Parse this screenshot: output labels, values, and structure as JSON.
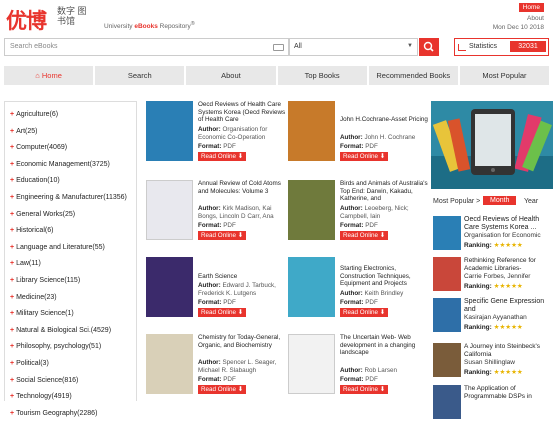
{
  "header": {
    "logo_cn": "优博",
    "logo_small": "数字 图书馆",
    "repo_prefix": "University ",
    "repo_brand": "eBooks",
    "repo_suffix": " Repository",
    "home": "Home",
    "about": "About",
    "date": "Mon Dec 10 2018"
  },
  "search": {
    "placeholder": "Search eBooks",
    "scope": "All"
  },
  "stats": {
    "label": "Statistics",
    "count": "32031"
  },
  "nav": [
    "Home",
    "Search",
    "About",
    "Top Books",
    "Recommended Books",
    "Most Popular"
  ],
  "categories": [
    "Agriculture(6)",
    "Art(25)",
    "Computer(4069)",
    "Economic Management(3725)",
    "Education(10)",
    "Engineering & Manufacturer(11356)",
    "General Works(25)",
    "Historical(6)",
    "Language and Literature(55)",
    "Law(11)",
    "Library Science(115)",
    "Medicine(23)",
    "Military Science(1)",
    "Natural & Biological Sci.(4529)",
    "Philosophy, psychology(51)",
    "Political(3)",
    "Social Science(816)",
    "Technology(4919)",
    "Tourism Geography(2286)"
  ],
  "labels": {
    "author": "Author:",
    "format": "Format:",
    "read": "Read Online",
    "ranking": "Ranking:"
  },
  "books": [
    {
      "title": "Oecd Reviews of Health Care Systems Korea (Oecd Reviews of Health Care",
      "author": "Organisation for Economic Co-Operation",
      "format": "PDF",
      "cover_color": "#2a7fb5"
    },
    {
      "title": "John H.Cochrane-Asset Pricing",
      "author": "John H. Cochrane",
      "format": "PDF",
      "cover_color": "#c77a2a"
    },
    {
      "title": "Annual Review of Cold Atoms and Molecules: Volume 3",
      "author": "Kirk Madison, Kai Bongs, Lincoln D Carr, Ana",
      "format": "PDF",
      "cover_color": "#e8e8ee"
    },
    {
      "title": "Birds and Animals of Australia's Top End: Darwin, Kakadu, Katherine, and",
      "author": "Leoeberg, Nick; Campbell, Iain",
      "format": "PDF",
      "cover_color": "#6f7a3c"
    },
    {
      "title": "Earth Science",
      "author": "Edward J. Tarbuck, Frederick K. Lutgens",
      "format": "PDF",
      "cover_color": "#3b2a6b"
    },
    {
      "title": "Starting Electronics, Construction Techniques, Equipment and Projects",
      "author": "Keith Brindley",
      "format": "PDF",
      "cover_color": "#3fa9c8"
    },
    {
      "title": "Chemistry for Today-General, Organic, and Biochemistry",
      "author": "Spencer L. Seager, Michael R. Slabaugh",
      "format": "PDF",
      "cover_color": "#d9d0b8"
    },
    {
      "title": "The Uncertain Web- Web development in a changing landscape",
      "author": "Rob Larsen",
      "format": "PDF",
      "cover_color": "#f2f2f2"
    }
  ],
  "popular": {
    "label": "Most Popular >",
    "month": "Month",
    "year": "Year",
    "items": [
      {
        "title": "Oecd Reviews of Health Care Systems Korea ...",
        "sub": "Organisation for Economic",
        "stars": "★★★★★"
      },
      {
        "title": "Rethinking Reference for Academic Libraries-",
        "sub": "Carrie Forbes, Jennifer",
        "stars": "★★★★★"
      },
      {
        "title": "Specific Gene Expression and",
        "sub": "Kasirajan Ayyanathan",
        "stars": "★★★★★"
      },
      {
        "title": "A Journey into Steinbeck's California",
        "sub": "Susan Shillinglaw",
        "stars": "★★★★★"
      },
      {
        "title": "The Application of Programmable DSPs in",
        "sub": "",
        "stars": ""
      }
    ]
  }
}
